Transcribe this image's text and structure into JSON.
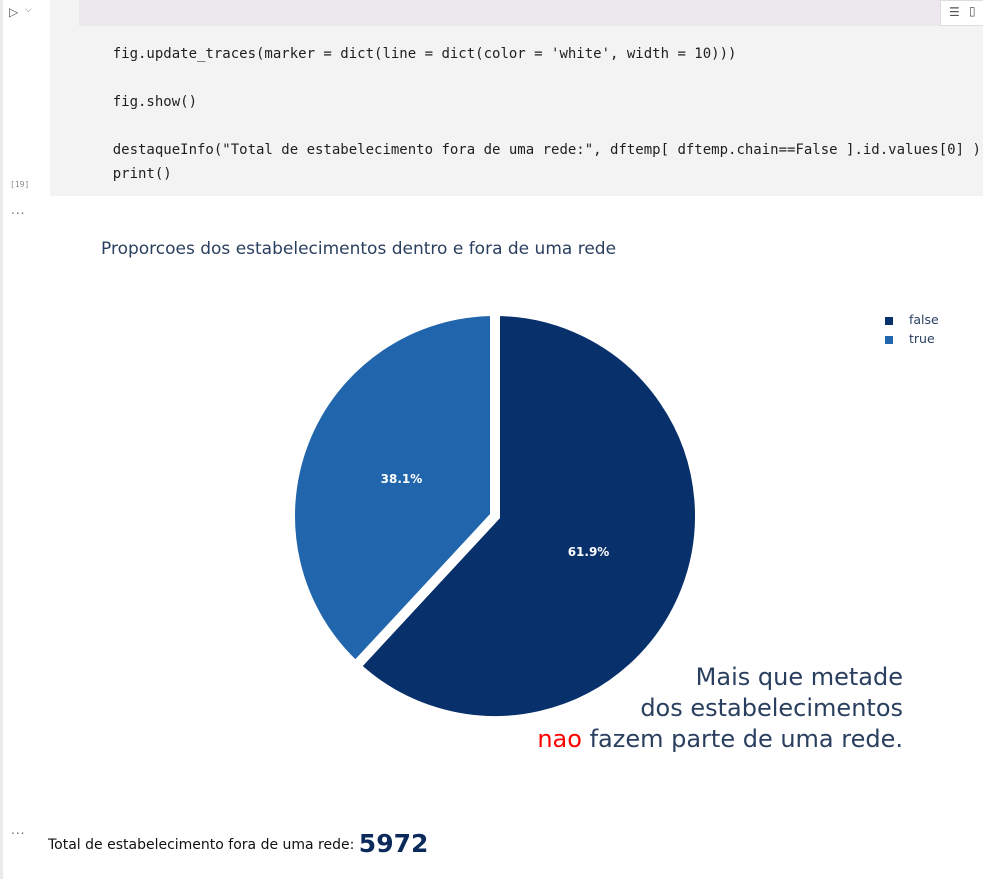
{
  "toolbar": {
    "run_icon": "▷",
    "chevron_icon": "⌵",
    "tool_a_icon": "☰",
    "tool_b_icon": "▯"
  },
  "code": {
    "lines": [
      "fig.update_traces(marker = dict(line = dict(color = 'white', width = 10)))",
      "fig.show()",
      "destaqueInfo(\"Total de estabelecimento fora de uma rede:\", dftemp[ dftemp.chain==False ].id.values[0] )",
      "print()"
    ],
    "execution_count": "[19]"
  },
  "output": {
    "ellipsis": "...",
    "ellipsis2": "..."
  },
  "chart_data": {
    "type": "pie",
    "title": "Proporcoes dos estabelecimentos dentro e fora de uma rede",
    "labels": [
      "false",
      "true"
    ],
    "values": [
      61.9,
      38.1
    ],
    "slice_labels": [
      "61.9%",
      "38.1%"
    ],
    "colors": [
      "#08306b",
      "#2166ac"
    ],
    "line_color": "white",
    "legend_position": "top-right"
  },
  "annotation": {
    "line1": "Mais que metade",
    "line2": "dos estabelecimentos",
    "highlight": "nao",
    "line3_rest": " fazem parte de uma rede."
  },
  "result": {
    "label": "Total de estabelecimento fora de uma rede:",
    "value": "5972"
  }
}
